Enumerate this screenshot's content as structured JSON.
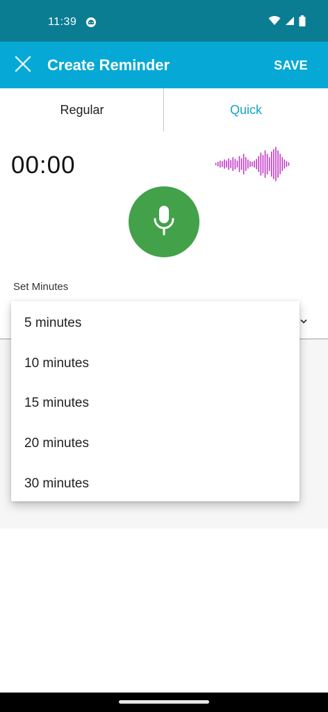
{
  "status_bar": {
    "time": "11:39",
    "icons": [
      "app-notification-icon",
      "wifi-icon",
      "cell-signal-icon",
      "battery-icon"
    ]
  },
  "app_bar": {
    "close_icon": "close-icon",
    "title": "Create Reminder",
    "save_label": "SAVE"
  },
  "tabs": [
    {
      "label": "Regular",
      "selected": false
    },
    {
      "label": "Quick",
      "selected": true
    }
  ],
  "timer": {
    "value": "00:00"
  },
  "mic": {
    "icon": "microphone-icon"
  },
  "minutes": {
    "label": "Set Minutes",
    "options": [
      "5 minutes",
      "10 minutes",
      "15 minutes",
      "20 minutes",
      "30 minutes"
    ]
  },
  "colors": {
    "status_bar": "#0a7d93",
    "app_bar": "#06a9d5",
    "accent": "#12a4c9",
    "mic_button": "#43a149",
    "waveform": "#c236c7"
  }
}
